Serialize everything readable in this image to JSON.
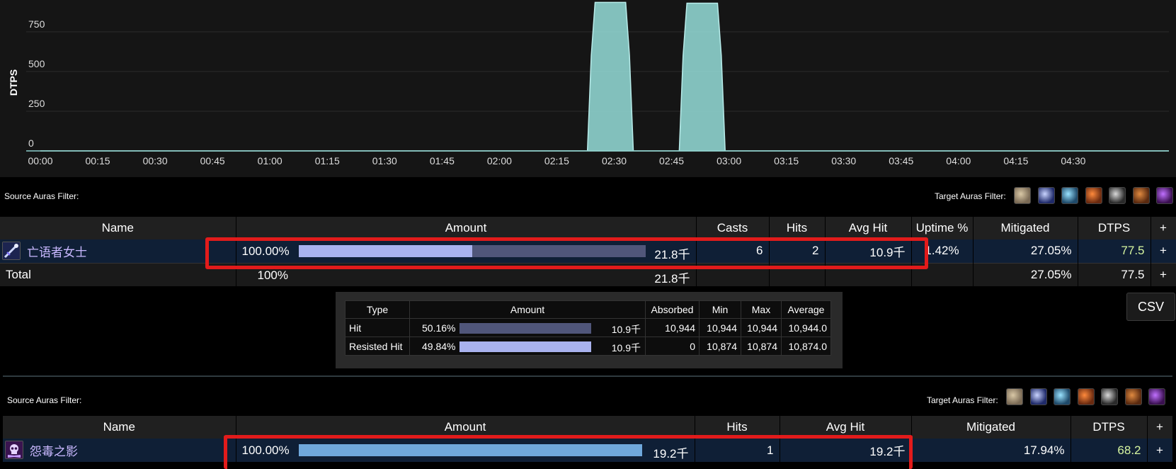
{
  "chart_data": {
    "type": "area",
    "title": "",
    "xlabel": "",
    "ylabel": "DTPS",
    "ylim": [
      0,
      950
    ],
    "yticks": [
      0,
      250,
      500,
      750
    ],
    "xticks": [
      "00:00",
      "00:15",
      "00:30",
      "00:45",
      "01:00",
      "01:15",
      "01:30",
      "01:45",
      "02:00",
      "02:15",
      "02:30",
      "02:45",
      "03:00",
      "03:15",
      "03:30",
      "03:45",
      "04:00",
      "04:15",
      "04:30"
    ],
    "xlim_seconds": [
      0,
      295
    ],
    "grid": true,
    "color": "#8ccfcb",
    "series": [
      {
        "x": [
          "00:00",
          "02:23",
          "02:24",
          "02:25",
          "02:33",
          "02:34",
          "02:35",
          "02:47",
          "02:48",
          "02:49",
          "02:57",
          "02:58",
          "02:59",
          "04:55"
        ],
        "values": [
          0,
          0,
          600,
          935,
          935,
          600,
          0,
          0,
          600,
          930,
          930,
          600,
          0,
          0
        ]
      }
    ]
  },
  "source_filter_label": "Source Auras Filter:",
  "target_filter_label": "Target Auras Filter:",
  "aura_icons": [
    "wolf-aura-icon",
    "arrow-aura-icon",
    "frost-aura-icon",
    "rage-aura-icon",
    "blades-aura-icon",
    "beast-aura-icon",
    "shadow-aura-icon"
  ],
  "table1": {
    "headers": {
      "name": "Name",
      "amount": "Amount",
      "casts": "Casts",
      "hits": "Hits",
      "avg_hit": "Avg Hit",
      "uptime": "Uptime %",
      "mitigated": "Mitigated",
      "dtps": "DTPS",
      "plus": "+"
    },
    "row": {
      "name": "亡语者女士",
      "pct": "100.00%",
      "amount": "21.8千",
      "casts": "6",
      "hits": "2",
      "avg_hit": "10.9千",
      "uptime": "1.42%",
      "mitigated": "27.05%",
      "dtps": "77.5",
      "plus": "+",
      "bar_dark_fraction": 1.0,
      "bar_light_fraction": 0.5,
      "bar_light_color": "#a9b2ee"
    },
    "total": {
      "name": "Total",
      "pct": "100%",
      "amount": "21.8千",
      "mitigated": "27.05%",
      "dtps": "77.5",
      "plus": "+"
    }
  },
  "breakdown": {
    "headers": {
      "type": "Type",
      "amount": "Amount",
      "absorbed": "Absorbed",
      "min": "Min",
      "max": "Max",
      "average": "Average"
    },
    "rows": [
      {
        "type": "Hit",
        "pct": "50.16%",
        "amount": "10.9千",
        "absorbed": "10,944",
        "min": "10,944",
        "max": "10,944",
        "average": "10,944.0",
        "bar_color": "#50567a"
      },
      {
        "type": "Resisted Hit",
        "pct": "49.84%",
        "amount": "10.9千",
        "absorbed": "0",
        "min": "10,874",
        "max": "10,874",
        "average": "10,874.0",
        "bar_color": "#a9b2ee"
      }
    ]
  },
  "csv_label": "CSV",
  "table2": {
    "headers": {
      "name": "Name",
      "amount": "Amount",
      "hits": "Hits",
      "avg_hit": "Avg Hit",
      "mitigated": "Mitigated",
      "dtps": "DTPS",
      "plus": "+"
    },
    "row": {
      "name": "怨毒之影",
      "pct": "100.00%",
      "amount": "19.2千",
      "hits": "1",
      "avg_hit": "19.2千",
      "mitigated": "17.94%",
      "dtps": "68.2",
      "plus": "+",
      "bar_fraction": 1.0,
      "bar_color": "#6fa8dc"
    }
  }
}
